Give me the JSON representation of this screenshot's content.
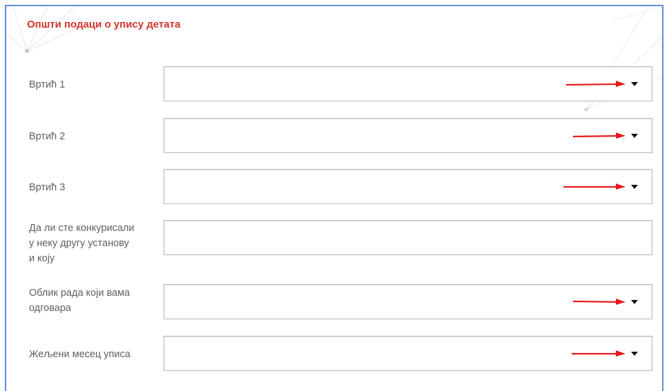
{
  "section": {
    "title": "Општи подаци о упису детата"
  },
  "fields": [
    {
      "label": "Вртић 1",
      "type": "select",
      "value": ""
    },
    {
      "label": "Вртић 2",
      "type": "select",
      "value": ""
    },
    {
      "label": "Вртић 3",
      "type": "select",
      "value": ""
    },
    {
      "label_lines": [
        "Да ли сте конкурисали",
        "у неку другу установу",
        "и коју"
      ],
      "type": "text",
      "value": ""
    },
    {
      "label_lines": [
        "Облик рада који вама",
        "одговара"
      ],
      "type": "select",
      "value": ""
    },
    {
      "label": "Жељени месец уписа",
      "type": "select",
      "value": ""
    }
  ],
  "colors": {
    "title": "#d0342c",
    "border_accent": "#5b8fd6",
    "annotation_arrow": "#e8191b"
  }
}
